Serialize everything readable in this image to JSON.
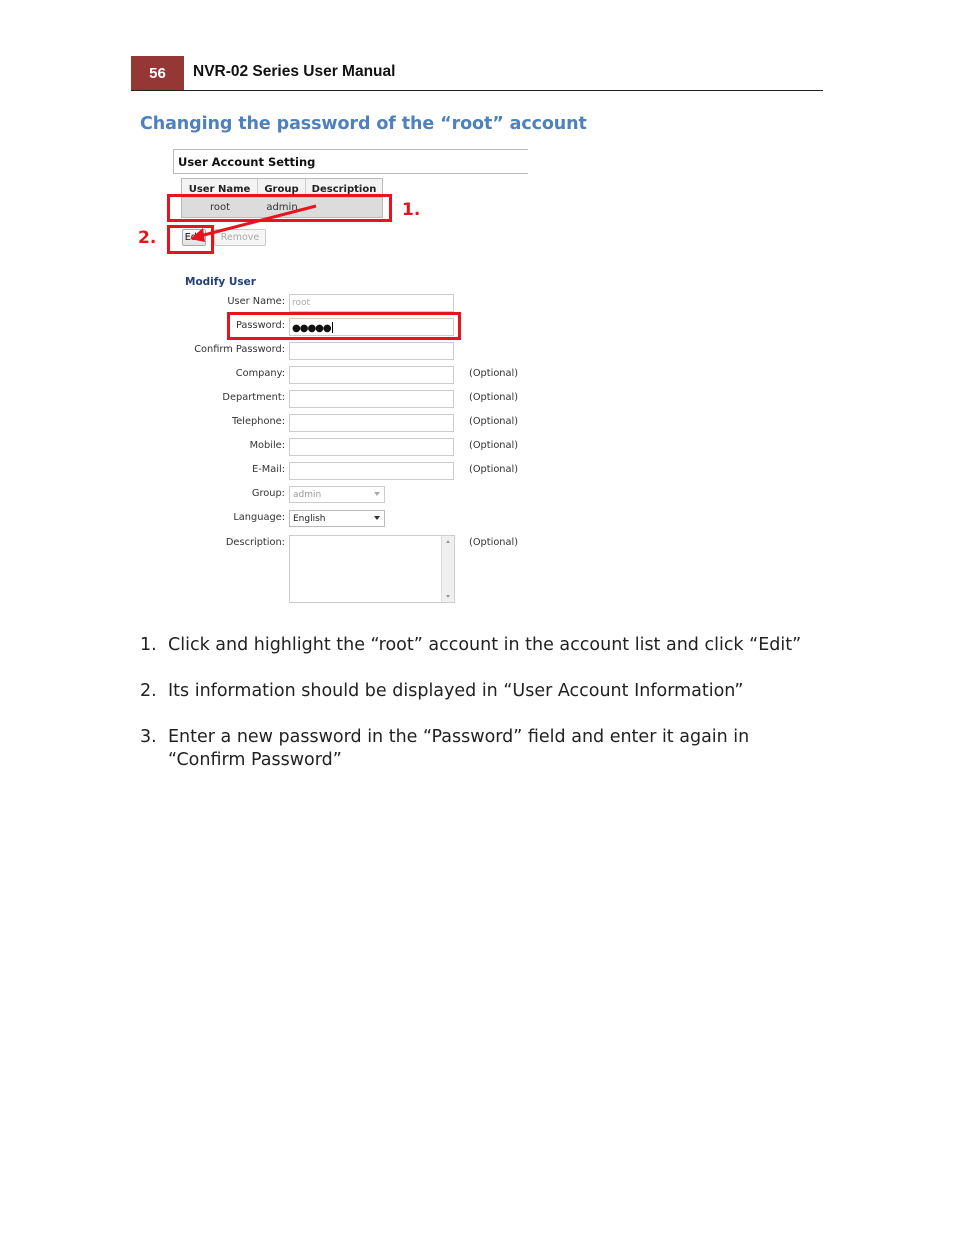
{
  "page_header": {
    "page_number": "56",
    "manual_title": "NVR-02 Series User Manual",
    "accent_color": "#953735"
  },
  "section": {
    "title": "Changing the password of the “root” account",
    "title_color": "#4f81bd"
  },
  "screenshot": {
    "panel_title": "User Account Setting",
    "table": {
      "columns": [
        "User Name",
        "Group",
        "Description"
      ],
      "rows": [
        {
          "user_name": "root",
          "group": "admin",
          "description": ""
        }
      ]
    },
    "buttons": {
      "edit": "Edit",
      "remove": "Remove"
    },
    "modify_user": {
      "title": "Modify User",
      "fields": {
        "user_name": {
          "label": "User Name:",
          "value": "root"
        },
        "password": {
          "label": "Password:",
          "value": "●●●●●"
        },
        "confirm_password": {
          "label": "Confirm Password:",
          "value": ""
        },
        "company": {
          "label": "Company:",
          "value": "",
          "note": "(Optional)"
        },
        "department": {
          "label": "Department:",
          "value": "",
          "note": "(Optional)"
        },
        "telephone": {
          "label": "Telephone:",
          "value": "",
          "note": "(Optional)"
        },
        "mobile": {
          "label": "Mobile:",
          "value": "",
          "note": "(Optional)"
        },
        "email": {
          "label": "E-Mail:",
          "value": "",
          "note": "(Optional)"
        },
        "group": {
          "label": "Group:",
          "value": "admin"
        },
        "language": {
          "label": "Language:",
          "value": "English"
        },
        "description": {
          "label": "Description:",
          "value": "",
          "note": "(Optional)"
        }
      }
    },
    "annotations": {
      "marker_1": "1.",
      "marker_2": "2.",
      "color": "#e8141b"
    }
  },
  "steps": [
    {
      "number": "1.",
      "text": "Click and highlight the “root” account in the account list and click “Edit”"
    },
    {
      "number": "2.",
      "text": "Its information should be displayed in “User Account Information”"
    },
    {
      "number": "3.",
      "text": "Enter a new password in the “Password” field and enter it again in “Confirm Password”"
    }
  ]
}
